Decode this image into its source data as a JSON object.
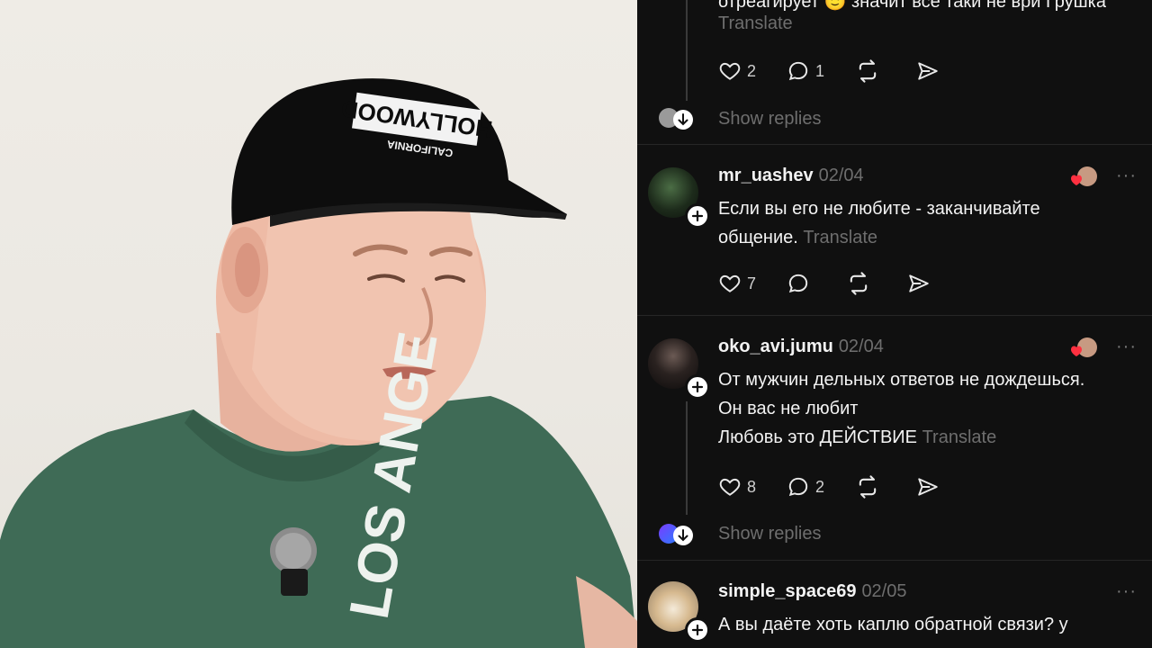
{
  "feed": {
    "top_post": {
      "partial_text": "отреагирует 🙂 значит все таки не ври Грушка",
      "translate": "Translate",
      "likes": "2",
      "replies": "1"
    },
    "show_replies_1": "Show replies",
    "comments": [
      {
        "username": "mr_uashev",
        "date": "02/04",
        "lines": [
          "Если вы его не любите - заканчивайте",
          "общение."
        ],
        "translate": "Translate",
        "likes": "7",
        "replies": ""
      },
      {
        "username": "oko_avi.jumu",
        "date": "02/04",
        "lines": [
          "От мужчин дельных ответов не дождешься.",
          "Он вас не любит",
          "Любовь это ДЕЙСТВИЕ"
        ],
        "translate": "Translate",
        "likes": "8",
        "replies": "2"
      },
      {
        "username": "simple_space69",
        "date": "02/05",
        "lines": [
          "А вы даёте хоть каплю обратной связи? у"
        ],
        "translate": "",
        "likes": "",
        "replies": ""
      }
    ],
    "show_replies_2": "Show replies",
    "more_label": "···"
  },
  "video": {
    "cap_logo_text": "HOLLYWOOD",
    "cap_logo_subtext": "CALIFORNIA",
    "shirt_text": "LOS ANGE"
  },
  "colors": {
    "feed_bg": "#101010",
    "text": "#f3f3f3",
    "muted": "#6e6e6e",
    "heart_red": "#ff3040",
    "shirt_green": "#3e6b55"
  }
}
